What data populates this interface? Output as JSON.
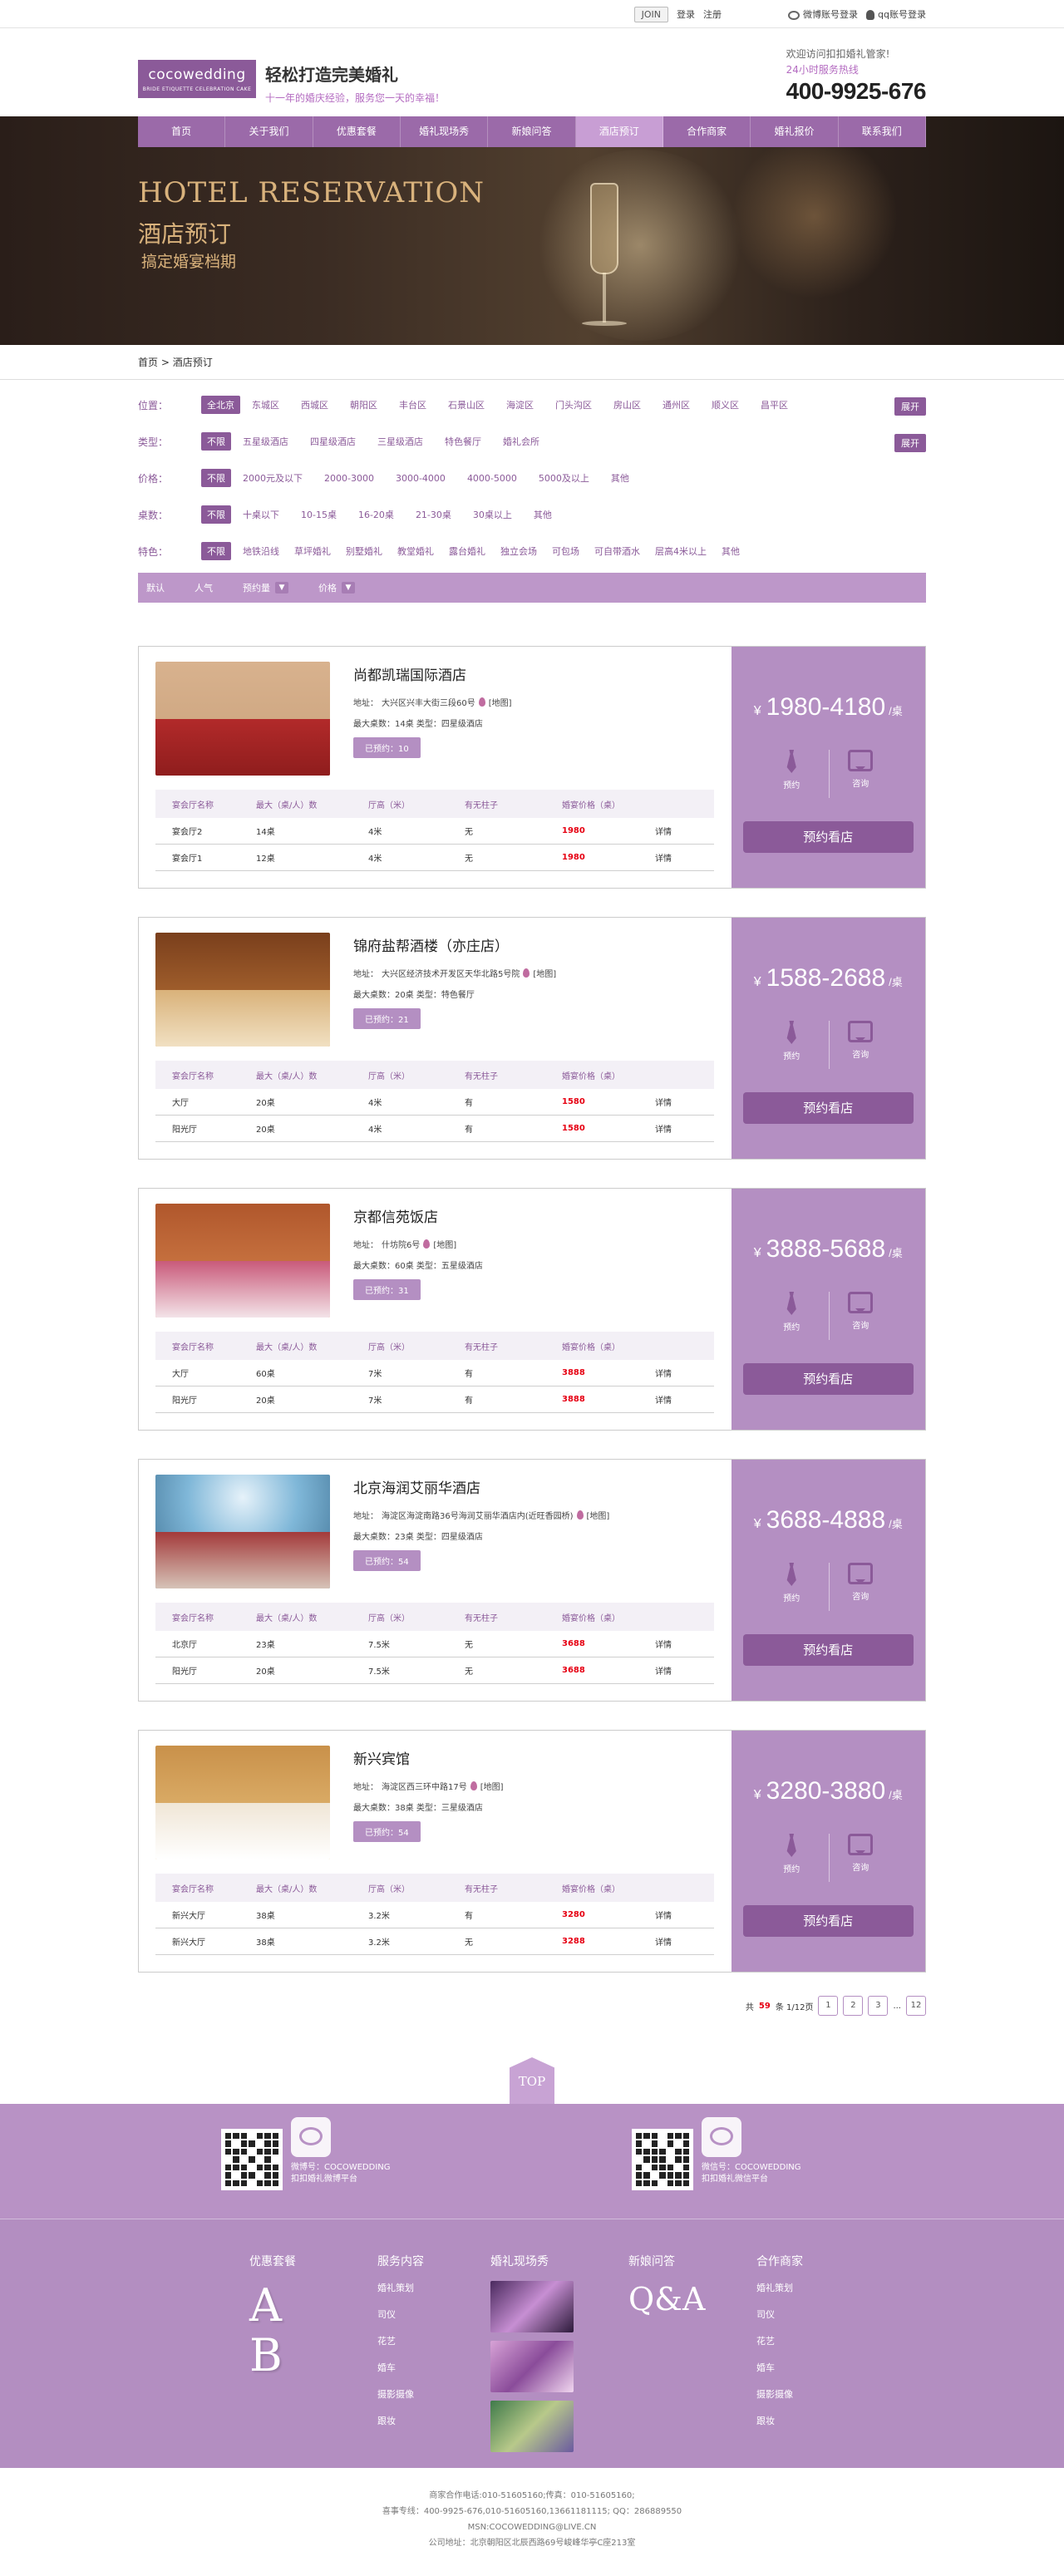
{
  "topbar": {
    "join": "JOIN",
    "login": "登录",
    "register": "注册",
    "weibo_login": "微博账号登录",
    "qq_login": "qq账号登录"
  },
  "header": {
    "logo_main": "cocowedding",
    "logo_sub": "BRIDE ETIQUETTE CELEBRATION CAKE",
    "slogan_main": "轻松打造完美婚礼",
    "slogan_sub": "十一年的婚庆经验，服务您一天的幸福！",
    "welcome": "欢迎访问扣扣婚礼管家!",
    "service_hours": "24小时服务热线",
    "phone": "400-9925-676"
  },
  "nav": [
    {
      "label": "首页"
    },
    {
      "label": "关于我们"
    },
    {
      "label": "优惠套餐"
    },
    {
      "label": "婚礼现场秀"
    },
    {
      "label": "新娘问答"
    },
    {
      "label": "酒店预订"
    },
    {
      "label": "合作商家"
    },
    {
      "label": "婚礼报价"
    },
    {
      "label": "联系我们"
    }
  ],
  "banner": {
    "en": "HOTEL RESERVATION",
    "cn": "酒店预订",
    "sub": "搞定婚宴档期"
  },
  "breadcrumb": {
    "home": "首页",
    "sep": ">",
    "current": "酒店预订"
  },
  "filters": {
    "location": {
      "label": "位置：",
      "selected": "全北京",
      "options": [
        "东城区",
        "西城区",
        "朝阳区",
        "丰台区",
        "石景山区",
        "海淀区",
        "门头沟区",
        "房山区",
        "通州区",
        "顺义区",
        "昌平区"
      ],
      "expand": "展开"
    },
    "type": {
      "label": "类型：",
      "selected": "不限",
      "options": [
        "五星级酒店",
        "四星级酒店",
        "三星级酒店",
        "特色餐厅",
        "婚礼会所"
      ],
      "expand": "展开"
    },
    "price": {
      "label": "价格：",
      "selected": "不限",
      "options": [
        "2000元及以下",
        "2000-3000",
        "3000-4000",
        "4000-5000",
        "5000及以上",
        "其他"
      ]
    },
    "tables": {
      "label": "桌数：",
      "selected": "不限",
      "options": [
        "十桌以下",
        "10-15桌",
        "16-20桌",
        "21-30桌",
        "30桌以上",
        "其他"
      ]
    },
    "feature": {
      "label": "特色：",
      "selected": "不限",
      "options": [
        "地铁沿线",
        "草坪婚礼",
        "别墅婚礼",
        "教堂婚礼",
        "露台婚礼",
        "独立会场",
        "可包场",
        "可自带酒水",
        "层高4米以上",
        "其他"
      ]
    }
  },
  "sortbar": {
    "default": "默认",
    "popular": "人气",
    "booked": "预约量",
    "price": "价格"
  },
  "table_headers": {
    "hall": "宴会厅名称",
    "max_tables": "最大（桌/人）数",
    "height": "厅高（米）",
    "pillar": "有无柱子",
    "price": "婚宴价格（桌）",
    "detail": ""
  },
  "labels": {
    "addr": "地址：",
    "map": "[地图]",
    "max": "最大桌数：",
    "type": "类型：",
    "booked": "已预约：",
    "yen": "¥",
    "unit": "/桌",
    "reserve": "预约",
    "consult": "咨询",
    "book_btn": "预约看店",
    "detail": "详情"
  },
  "hotels": [
    {
      "name": "尚都凯瑞国际酒店",
      "addr": "大兴区兴丰大街三段60号",
      "max": "14桌",
      "type": "四星级酒店",
      "booked": "10",
      "price": "1980-4180",
      "halls": [
        {
          "name": "宴会厅2",
          "max": "14桌",
          "height": "4米",
          "pillar": "无",
          "price": "1980"
        },
        {
          "name": "宴会厅1",
          "max": "12桌",
          "height": "4米",
          "pillar": "无",
          "price": "1980"
        }
      ]
    },
    {
      "name": "锦府盐帮酒楼（亦庄店）",
      "addr": "大兴区经济技术开发区天华北路5号院",
      "max": "20桌",
      "type": "特色餐厅",
      "booked": "21",
      "price": "1588-2688",
      "halls": [
        {
          "name": "大厅",
          "max": "20桌",
          "height": "4米",
          "pillar": "有",
          "price": "1580"
        },
        {
          "name": "阳光厅",
          "max": "20桌",
          "height": "4米",
          "pillar": "有",
          "price": "1580"
        }
      ]
    },
    {
      "name": "京都信苑饭店",
      "addr": "什坊院6号",
      "max": "60桌",
      "type": "五星级酒店",
      "booked": "31",
      "price": "3888-5688",
      "halls": [
        {
          "name": "大厅",
          "max": "60桌",
          "height": "7米",
          "pillar": "有",
          "price": "3888"
        },
        {
          "name": "阳光厅",
          "max": "20桌",
          "height": "7米",
          "pillar": "有",
          "price": "3888"
        }
      ]
    },
    {
      "name": "北京海润艾丽华酒店",
      "addr": "海淀区海淀南路36号海润艾丽华酒店内(近旺香园桥)",
      "max": "23桌",
      "type": "四星级酒店",
      "booked": "54",
      "price": "3688-4888",
      "halls": [
        {
          "name": "北京厅",
          "max": "23桌",
          "height": "7.5米",
          "pillar": "无",
          "price": "3688"
        },
        {
          "name": "阳光厅",
          "max": "20桌",
          "height": "7.5米",
          "pillar": "无",
          "price": "3688"
        }
      ]
    },
    {
      "name": "新兴宾馆",
      "addr": "海淀区西三环中路17号",
      "max": "38桌",
      "type": "三星级酒店",
      "booked": "54",
      "price": "3280-3880",
      "halls": [
        {
          "name": "新兴大厅",
          "max": "38桌",
          "height": "3.2米",
          "pillar": "有",
          "price": "3280"
        },
        {
          "name": "新兴大厅",
          "max": "38桌",
          "height": "3.2米",
          "pillar": "无",
          "price": "3288"
        }
      ]
    }
  ],
  "pager": {
    "prefix": "共",
    "count": "59",
    "suffix": "条 1/12页",
    "pages": [
      "1",
      "2",
      "3",
      "...",
      "12"
    ]
  },
  "footer": {
    "top": "TOP",
    "weibo_label": "微博号：COCOWEDDING",
    "weibo_sub": "扣扣婚礼微博平台",
    "wechat_label": "微信号：COCOWEDDING",
    "wechat_sub": "扣扣婚礼微信平台",
    "cols": {
      "packages": {
        "title": "优惠套餐",
        "a": "A",
        "b": "B"
      },
      "services": {
        "title": "服务内容",
        "items": [
          "婚礼策划",
          "司仪",
          "花艺",
          "婚车",
          "摄影摄像",
          "跟妆"
        ]
      },
      "show": {
        "title": "婚礼现场秀"
      },
      "qa": {
        "title": "新娘问答",
        "logo": "Q&A"
      },
      "partners": {
        "title": "合作商家",
        "items": [
          "婚礼策划",
          "司仪",
          "花艺",
          "婚车",
          "摄影摄像",
          "跟妆"
        ]
      }
    },
    "copy": [
      "商家合作电话:010-51605160;传真：010-51605160;",
      "喜事专线：400-9925-676,010-51605160,13661181115; QQ：286889550",
      "MSN:COCOWEDDING@LIVE.CN",
      "公司地址：北京朝阳区北辰西路69号峻峰华亭C座213室"
    ]
  }
}
